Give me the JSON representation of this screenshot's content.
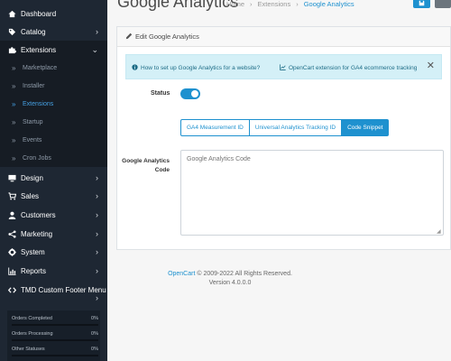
{
  "sidebar": {
    "items": [
      {
        "label": "Dashboard",
        "icon": "dashboard-icon"
      },
      {
        "label": "Catalog",
        "icon": "tag-icon"
      },
      {
        "label": "Extensions",
        "icon": "puzzle-icon"
      },
      {
        "label": "Design",
        "icon": "monitor-icon"
      },
      {
        "label": "Sales",
        "icon": "cart-icon"
      },
      {
        "label": "Customers",
        "icon": "user-icon"
      },
      {
        "label": "Marketing",
        "icon": "share-icon"
      },
      {
        "label": "System",
        "icon": "gear-icon"
      },
      {
        "label": "Reports",
        "icon": "bar-chart-icon"
      },
      {
        "label": "TMD Custom Footer Menu",
        "icon": "code-icon"
      }
    ],
    "subitems": [
      {
        "label": "Marketplace"
      },
      {
        "label": "Installer"
      },
      {
        "label": "Extensions"
      },
      {
        "label": "Startup"
      },
      {
        "label": "Events"
      },
      {
        "label": "Cron Jobs"
      }
    ],
    "stats": [
      {
        "label": "Orders Completed",
        "value": "0%"
      },
      {
        "label": "Orders Processing",
        "value": "0%"
      },
      {
        "label": "Other Statuses",
        "value": "0%"
      }
    ]
  },
  "header": {
    "title": "Google Analytics",
    "breadcrumb": [
      "Home",
      "Extensions",
      "Google Analytics"
    ]
  },
  "card": {
    "title": "Edit Google Analytics",
    "alert_link1": "How to set up Google Analytics for a website?",
    "alert_link2": "OpenCart extension for GA4 ecommerce tracking",
    "status_label": "Status",
    "status_on": true,
    "tabs": [
      "GA4 Measurement ID",
      "Universal Analytics Tracking ID",
      "Code Snippet"
    ],
    "code_label": "Google Analytics Code",
    "code_placeholder": "Google Analytics Code"
  },
  "footer": {
    "link": "OpenCart",
    "copyright": " © 2009-2022 All Rights Reserved.",
    "version": "Version 4.0.0.0"
  },
  "colors": {
    "accent": "#1e91cf",
    "sidebar": "#1e2733",
    "alert_bg": "#d4f0f7"
  }
}
